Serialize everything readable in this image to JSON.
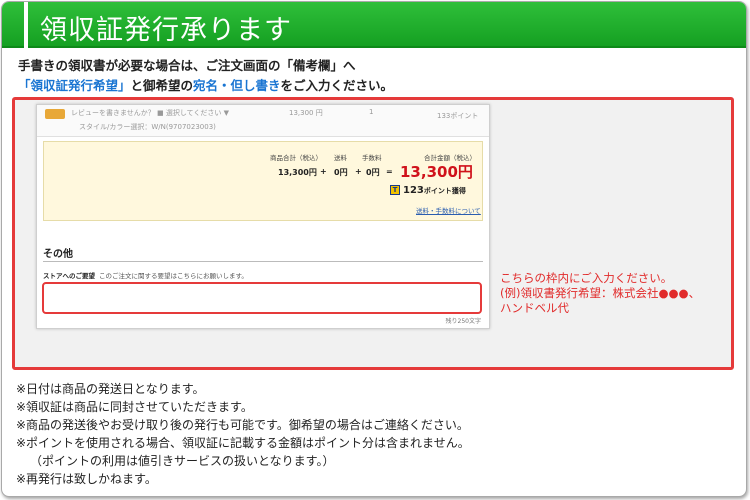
{
  "header": {
    "title": "領収証発行承ります",
    "accent": "#1aa52a"
  },
  "intro": {
    "line1": "手書きの領収書が必要な場合は、ご注文画面の「備考欄」へ",
    "line2_part1": "「領収証発行希望」",
    "line2_part2": "と御希望の",
    "line2_part3": "宛名・但し書き",
    "line2_part4": "をご入力ください。"
  },
  "screenshot": {
    "top_row": {
      "review": "レビューを書きませんか？",
      "select": "■ 選択してください ▼",
      "price": "13,300 円",
      "qty": "1",
      "points": "133ポイント",
      "variant": "スタイル/カラー選択：W/N(9707023003)"
    },
    "totals": {
      "subtotal_label": "商品合計（税込）",
      "shipping_label": "送料",
      "fee_label": "手数料",
      "total_label": "合計金額（税込）",
      "subtotal": "13,300円",
      "plus1": "+",
      "shipping": "0円",
      "plus2": "+",
      "fee": "0円",
      "equals": "=",
      "total": "13,300円",
      "points_icon": "T",
      "points_value": "123",
      "points_suffix": "ポイント獲得",
      "fee_link": "送料・手数料について"
    },
    "other": {
      "title": "その他",
      "request_label": "ストアへのご要望",
      "request_hint": "このご注文に関する要望はこちらにお願いします。",
      "remaining": "残り250文字"
    }
  },
  "annotation": {
    "line1": "こちらの枠内にご入力ください。",
    "line2": "(例)領収書発行希望：株式会社●●●、",
    "line3": "ハンドベル代",
    "color": "#e12b2b"
  },
  "notes": [
    "※日付は商品の発送日となります。",
    "※領収証は商品に同封させていただきます。",
    "※商品の発送後やお受け取り後の発行も可能です。御希望の場合はご連絡ください。",
    "※ポイントを使用される場合、領収証に記載する金額はポイント分は含まれません。",
    "（ポイントの利用は値引きサービスの扱いとなります。）",
    "※再発行は致しかねます。"
  ]
}
